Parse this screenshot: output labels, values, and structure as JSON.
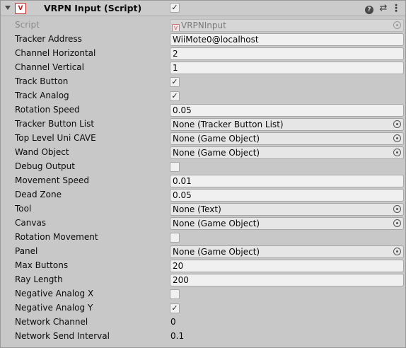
{
  "header": {
    "title": "VRPN Input (Script)",
    "icon_letter": "V",
    "enabled": "✓",
    "icons": [
      "fold-arrow-icon",
      "script-icon",
      "help-icon",
      "preset-icon",
      "context-menu-icon"
    ]
  },
  "props": {
    "script": {
      "label": "Script",
      "value": "VRPNInput"
    },
    "tracker_address": {
      "label": "Tracker Address",
      "value": "WiiMote0@localhost"
    },
    "channel_horizontal": {
      "label": "Channel Horizontal",
      "value": "2"
    },
    "channel_vertical": {
      "label": "Channel Vertical",
      "value": "1"
    },
    "track_button": {
      "label": "Track Button",
      "checked": "✓"
    },
    "track_analog": {
      "label": "Track Analog",
      "checked": "✓"
    },
    "rotation_speed": {
      "label": "Rotation Speed",
      "value": "0.05"
    },
    "tracker_button_list": {
      "label": "Tracker Button List",
      "value": "None (Tracker Button List)"
    },
    "top_level_uni_cave": {
      "label": "Top Level Uni CAVE",
      "value": "None (Game Object)"
    },
    "wand_object": {
      "label": "Wand Object",
      "value": "None (Game Object)"
    },
    "debug_output": {
      "label": "Debug Output",
      "checked": ""
    },
    "movement_speed": {
      "label": "Movement Speed",
      "value": "0.01"
    },
    "dead_zone": {
      "label": "Dead Zone",
      "value": "0.05"
    },
    "tool": {
      "label": "Tool",
      "value": "None (Text)"
    },
    "canvas": {
      "label": "Canvas",
      "value": "None (Game Object)"
    },
    "rotation_movement": {
      "label": "Rotation Movement",
      "checked": ""
    },
    "panel": {
      "label": "Panel",
      "value": "None (Game Object)"
    },
    "max_buttons": {
      "label": "Max Buttons",
      "value": "20"
    },
    "ray_length": {
      "label": "Ray Length",
      "value": "200"
    },
    "negative_analog_x": {
      "label": "Negative Analog X",
      "checked": ""
    },
    "negative_analog_y": {
      "label": "Negative Analog Y",
      "checked": "✓"
    },
    "network_channel": {
      "label": "Network Channel",
      "value": "0"
    },
    "network_send_interval": {
      "label": "Network Send Interval",
      "value": "0.1"
    }
  },
  "colors": {
    "panel_bg": "#c8c8c8",
    "field_bg": "#f0f0f0",
    "field_border": "#a6a6a6",
    "script_icon_red": "#bb2222"
  }
}
